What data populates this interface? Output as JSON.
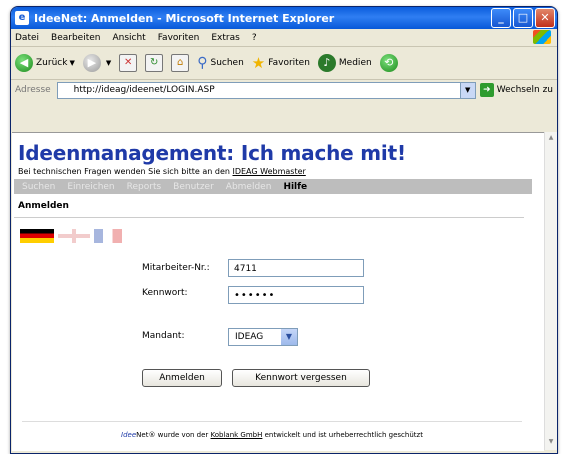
{
  "window": {
    "title": "IdeeNet: Anmelden - Microsoft Internet Explorer"
  },
  "menu": [
    "Datei",
    "Bearbeiten",
    "Ansicht",
    "Favoriten",
    "Extras",
    "?"
  ],
  "toolbar": {
    "back": "Zurück",
    "search": "Suchen",
    "favorites": "Favoriten",
    "media": "Medien"
  },
  "address": {
    "label": "Adresse",
    "url": "http://ideag/ideenet/LOGIN.ASP",
    "go": "Wechseln zu"
  },
  "page": {
    "title": "Ideenmanagement: Ich mache mit!",
    "subline_prefix": "Bei technischen Fragen wenden Sie sich bitte an den",
    "subline_link": "IDEAG Webmaster",
    "nav": [
      "Suchen",
      "Einreichen",
      "Reports",
      "Benutzer",
      "Abmelden",
      "Hilfe"
    ],
    "section": "Anmelden",
    "form": {
      "employee_label": "Mitarbeiter-Nr.:",
      "employee_value": "4711",
      "password_label": "Kennwort:",
      "password_value": "••••••",
      "client_label": "Mandant:",
      "client_value": "IDEAG",
      "login_button": "Anmelden",
      "forgot_button": "Kennwort vergessen"
    },
    "footer": {
      "brand": "Idee",
      "text1": "Net® wurde von der",
      "link": "Koblank GmbH",
      "text2": "entwickelt und ist urheberrechtlich geschützt"
    }
  },
  "colors": {
    "title_blue": "#1f3aa8",
    "nav_gray": "#bdbdbd"
  }
}
